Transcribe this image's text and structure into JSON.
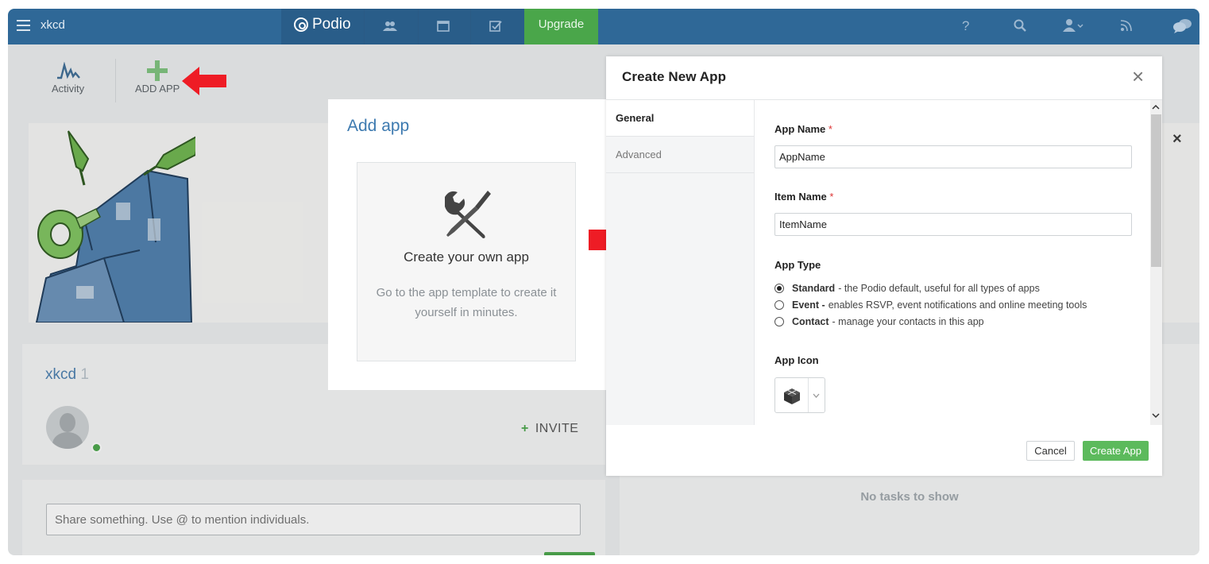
{
  "topbar": {
    "workspace": "xkcd",
    "brand": "Podio",
    "upgrade_label": "Upgrade",
    "nav_icons": [
      "contacts-icon",
      "calendar-icon",
      "tasks-icon",
      "help-icon",
      "search-icon",
      "profile-icon",
      "feed-icon",
      "chat-icon"
    ],
    "help_glyph": "?",
    "color_bar": "#2f6897",
    "color_upgrade": "#4aa64a"
  },
  "tools": {
    "activity_label": "Activity",
    "add_app_label": "ADD APP"
  },
  "workspace_card": {
    "name": "xkcd",
    "member_count": "1",
    "invite_label": "INVITE",
    "invite_plus": "+"
  },
  "share": {
    "placeholder": "Share something. Use @ to mention individuals."
  },
  "tasks": {
    "empty_text": "No tasks to show"
  },
  "add_app_modal": {
    "title": "Add app",
    "option_title": "Create your own app",
    "option_desc": "Go to the app template to create it yourself in minutes."
  },
  "create_app_modal": {
    "title": "Create New App",
    "close_glyph": "×",
    "tabs": [
      {
        "label": "General",
        "active": true
      },
      {
        "label": "Advanced",
        "active": false
      }
    ],
    "app_name_label": "App Name",
    "app_name_value": "AppName",
    "item_name_label": "Item Name",
    "item_name_value": "ItemName",
    "required_mark": "*",
    "app_type_label": "App Type",
    "app_types": [
      {
        "name": "Standard",
        "desc": " - the Podio default, useful for all types of apps",
        "checked": true
      },
      {
        "name": "Event -",
        "desc": " enables RSVP, event notifications and online meeting tools",
        "checked": false
      },
      {
        "name": "Contact",
        "desc": " - manage your contacts in this app",
        "checked": false
      }
    ],
    "app_icon_label": "App Icon",
    "app_icon": "cube-icon",
    "cancel_label": "Cancel",
    "create_label": "Create App",
    "accent": "#5cba5c"
  },
  "banner_close_glyph": "×"
}
